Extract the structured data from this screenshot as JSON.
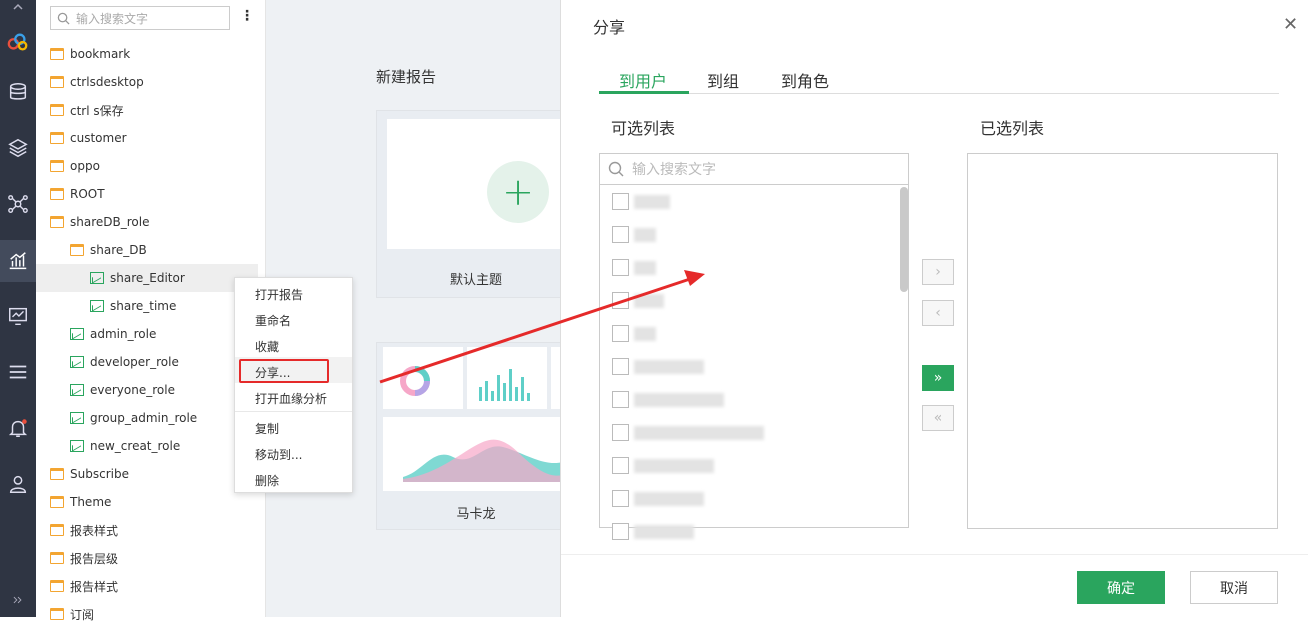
{
  "tree": {
    "search_placeholder": "输入搜索文字",
    "items": [
      {
        "label": "bookmark",
        "type": "folder"
      },
      {
        "label": "ctrlsdesktop",
        "type": "folder"
      },
      {
        "label": "ctrl s保存",
        "type": "folder"
      },
      {
        "label": "customer",
        "type": "folder"
      },
      {
        "label": "oppo",
        "type": "folder"
      },
      {
        "label": "ROOT",
        "type": "folder"
      },
      {
        "label": "shareDB_role",
        "type": "folder"
      },
      {
        "label": "share_DB",
        "type": "folder"
      },
      {
        "label": "share_Editor",
        "type": "report"
      },
      {
        "label": "share_time",
        "type": "report"
      },
      {
        "label": "admin_role",
        "type": "report"
      },
      {
        "label": "developer_role",
        "type": "report"
      },
      {
        "label": "everyone_role",
        "type": "report"
      },
      {
        "label": "group_admin_role",
        "type": "report"
      },
      {
        "label": "new_creat_role",
        "type": "report"
      },
      {
        "label": "Subscribe",
        "type": "folder"
      },
      {
        "label": "Theme",
        "type": "folder"
      },
      {
        "label": "报表样式",
        "type": "folder"
      },
      {
        "label": "报告层级",
        "type": "folder"
      },
      {
        "label": "报告样式",
        "type": "folder"
      },
      {
        "label": "订阅",
        "type": "folder"
      }
    ]
  },
  "main": {
    "title": "新建报告",
    "card1_label": "默认主题",
    "card2_label": "马卡龙"
  },
  "menu": {
    "items": [
      "打开报告",
      "重命名",
      "收藏",
      "分享...",
      "打开血缘分析",
      "复制",
      "移动到...",
      "删除"
    ]
  },
  "dialog": {
    "title": "分享",
    "tabs": [
      "到用户",
      "到组",
      "到角色"
    ],
    "available_title": "可选列表",
    "selected_title": "已选列表",
    "search_placeholder": "输入搜索文字",
    "ok": "确定",
    "cancel": "取消"
  },
  "colors": {
    "accent": "#2aa55e",
    "sidebar": "#2f3543",
    "highlight": "#e52a2a",
    "folder": "#f3a531"
  }
}
